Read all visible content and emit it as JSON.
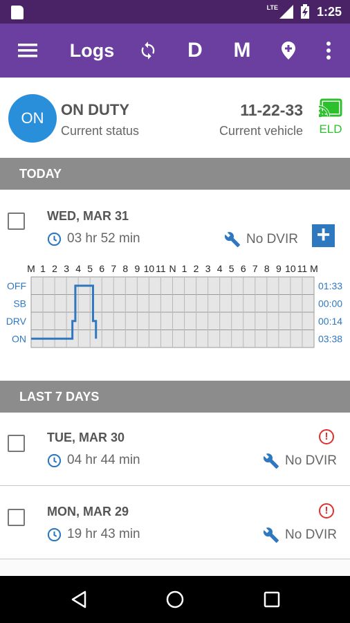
{
  "status_bar": {
    "network": "LTE",
    "time": "1:25"
  },
  "app_bar": {
    "title": "Logs",
    "day_button": "D",
    "month_button": "M"
  },
  "current": {
    "status_badge": "ON",
    "status_text": "ON DUTY",
    "status_caption": "Current status",
    "vehicle": "11-22-33",
    "vehicle_caption": "Current vehicle",
    "eld_label": "ELD"
  },
  "today": {
    "section_label": "TODAY",
    "date": "WED, MAR 31",
    "duration": "03 hr  52 min",
    "dvir": "No DVIR",
    "add_label": "+"
  },
  "graph": {
    "hour_labels": [
      "M",
      "1",
      "2",
      "3",
      "4",
      "5",
      "6",
      "7",
      "8",
      "9",
      "10",
      "11",
      "N",
      "1",
      "2",
      "3",
      "4",
      "5",
      "6",
      "7",
      "8",
      "9",
      "10",
      "11",
      "M"
    ],
    "status_labels": [
      "OFF",
      "SB",
      "DRV",
      "ON"
    ],
    "totals": [
      "01:33",
      "00:00",
      "00:14",
      "03:38"
    ],
    "line_color": "#2e78c0",
    "segments": [
      {
        "status": "ON",
        "from": 0,
        "to": 3.5
      },
      {
        "status": "DRV",
        "from": 3.5,
        "to": 3.75
      },
      {
        "status": "OFF",
        "from": 3.75,
        "to": 5.25
      },
      {
        "status": "DRV",
        "from": 5.25,
        "to": 5.5
      },
      {
        "status": "ON",
        "from": 5.5,
        "to": 5.5
      }
    ]
  },
  "last7": {
    "section_label": "LAST 7 DAYS",
    "rows": [
      {
        "date": "TUE, MAR 30",
        "duration": "04 hr  44 min",
        "dvir": "No DVIR",
        "alert": "!"
      },
      {
        "date": "MON, MAR 29",
        "duration": "19 hr  43 min",
        "dvir": "No DVIR",
        "alert": "!"
      }
    ]
  }
}
